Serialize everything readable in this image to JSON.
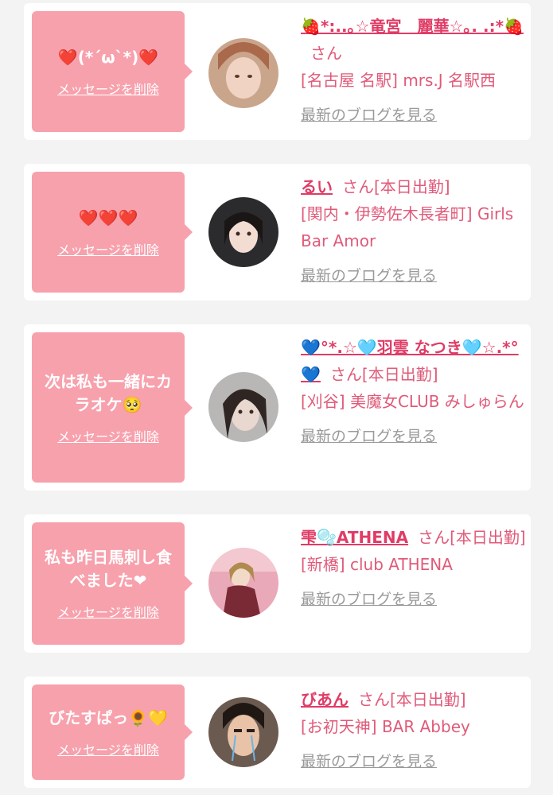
{
  "items": [
    {
      "message": "❤️(*´ω`*)❤️",
      "delete_label": "メッセージを削除",
      "name": "🍓*:..｡☆竜宮　麗華☆｡. .:*🍓",
      "san": "さん",
      "status": "",
      "shop": "[名古屋 名駅] mrs.J 名駅西",
      "blog_label": "最新のブログを見る",
      "avatar_icon": "profile-photo"
    },
    {
      "message": "❤️❤️❤️",
      "delete_label": "メッセージを削除",
      "name": "るい",
      "san": "さん",
      "status": "[本日出勤]",
      "shop": "[関内・伊勢佐木長者町] Girls Bar Amor",
      "blog_label": "最新のブログを見る",
      "avatar_icon": "profile-photo"
    },
    {
      "message": "次は私も一緒にカラオケ🥺",
      "delete_label": "メッセージを削除",
      "name": "💙°*.☆🩵羽雲 なつき🩵☆.*°💙",
      "san": "さん",
      "status": "[本日出勤]",
      "shop": "[刈谷] 美魔女CLUB みしゅらん",
      "blog_label": "最新のブログを見る",
      "avatar_icon": "profile-photo"
    },
    {
      "message": "私も昨日馬刺し食べました❤",
      "delete_label": "メッセージを削除",
      "name": "雫🫧ATHENA",
      "san": "さん",
      "status": "[本日出勤]",
      "shop": "[新橋] club ATHENA",
      "blog_label": "最新のブログを見る",
      "avatar_icon": "profile-photo"
    },
    {
      "message": "びたすぱっ🌻💛",
      "delete_label": "メッセージを削除",
      "name": "びあん",
      "san": "さん",
      "status": "[本日出勤]",
      "shop": "[お初天神] BAR Abbey",
      "blog_label": "最新のブログを見る",
      "avatar_icon": "profile-photo"
    }
  ],
  "colors": {
    "bubble": "#f7a1ad",
    "name": "#e03c66",
    "text": "#e05a79",
    "link_gray": "#9a9a9a",
    "background": "#f3f3f3"
  }
}
